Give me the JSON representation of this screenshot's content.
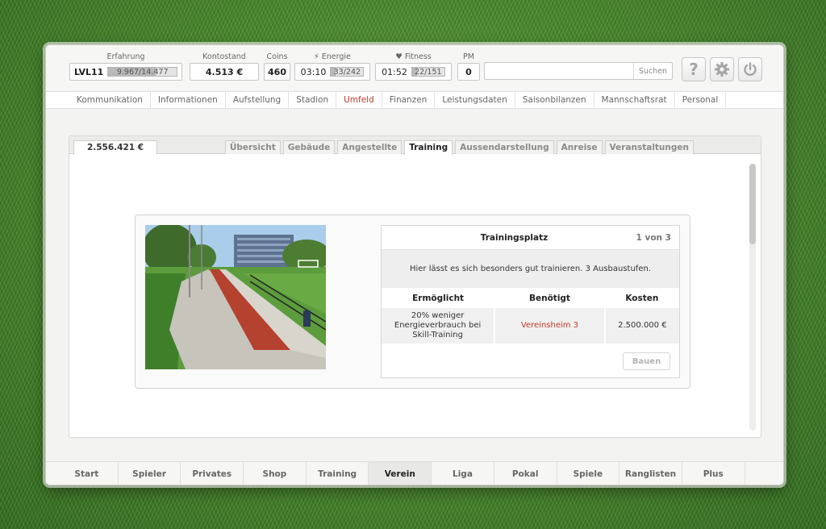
{
  "stats": {
    "experience": {
      "label": "Erfahrung",
      "level": "LVL11",
      "value": "9.967/14.477",
      "progress": 0.688
    },
    "balance": {
      "label": "Kontostand",
      "value": "4.513 €"
    },
    "coins": {
      "label": "Coins",
      "value": "460"
    },
    "energy": {
      "label": "Energie",
      "time": "03:10",
      "value": "33/242",
      "progress": 0.136
    },
    "fitness": {
      "label": "Fitness",
      "time": "01:52",
      "value": "22/151",
      "progress": 0.146
    },
    "pm": {
      "label": "PM",
      "value": "0"
    }
  },
  "search": {
    "placeholder": "",
    "button": "Suchen"
  },
  "icons": {
    "help": "question-icon",
    "settings": "gear-icon",
    "power": "power-icon"
  },
  "nav": [
    "Kommunikation",
    "Informationen",
    "Aufstellung",
    "Stadion",
    "Umfeld",
    "Finanzen",
    "Leistungsdaten",
    "Saisonbilanzen",
    "Mannschaftsrat",
    "Personal"
  ],
  "nav_active": "Umfeld",
  "content": {
    "money": "2.556.421 €",
    "tabs": [
      "Übersicht",
      "Gebäude",
      "Angestellte",
      "Training",
      "Aussendarstellung",
      "Anreise",
      "Veranstaltungen"
    ],
    "active_tab": "Training"
  },
  "building": {
    "title": "Trainingsplatz",
    "count": "1 von 3",
    "description": "Hier lässt es sich besonders gut trainieren. 3 Ausbaustufen.",
    "table": {
      "headers": [
        "Ermöglicht",
        "Benötigt",
        "Kosten"
      ],
      "row": [
        "20% weniger Energieverbrauch bei Skill-Training",
        "Vereinsheim 3",
        "2.500.000 €"
      ]
    },
    "build_button": "Bauen"
  },
  "bottom_nav": [
    "Start",
    "Spieler",
    "Privates",
    "Shop",
    "Training",
    "Verein",
    "Liga",
    "Pokal",
    "Spiele",
    "Ranglisten",
    "Plus"
  ],
  "bottom_active": "Verein",
  "colors": {
    "accent_red": "#c0392b",
    "grass": "#4a8a2c"
  }
}
